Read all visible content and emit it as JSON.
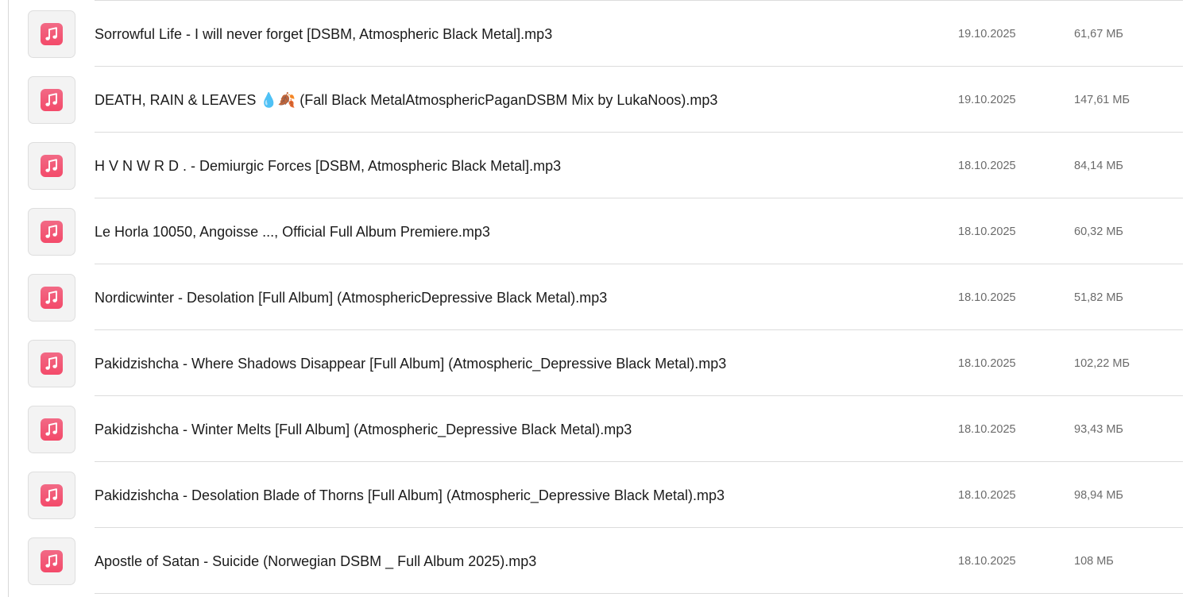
{
  "files": [
    {
      "name": "Sorrowful Life - I will never forget [DSBM, Atmospheric Black Metal].mp3",
      "date": "19.10.2025",
      "size": "61,67 МБ",
      "icon": "music-note-icon"
    },
    {
      "name": "DEATH, RAIN & LEAVES 💧🍂 (Fall Black MetalAtmosphericPaganDSBM Mix by LukaNoos).mp3",
      "date": "19.10.2025",
      "size": "147,61 МБ",
      "icon": "music-note-icon"
    },
    {
      "name": "H V N W R D . - Demiurgic Forces [DSBM, Atmospheric Black Metal].mp3",
      "date": "18.10.2025",
      "size": "84,14 МБ",
      "icon": "music-note-icon"
    },
    {
      "name": "Le Horla 10050, Angoisse ...,  Official Full Album Premiere.mp3",
      "date": "18.10.2025",
      "size": "60,32 МБ",
      "icon": "music-note-icon"
    },
    {
      "name": "Nordicwinter - Desolation [Full Album] (AtmosphericDepressive Black Metal).mp3",
      "date": "18.10.2025",
      "size": "51,82 МБ",
      "icon": "music-note-icon"
    },
    {
      "name": "Pakidzishcha - Where Shadows Disappear [Full Album] (Atmospheric_Depressive Black Metal).mp3",
      "date": "18.10.2025",
      "size": "102,22 МБ",
      "icon": "music-note-icon"
    },
    {
      "name": "Pakidzishcha - Winter Melts [Full Album] (Atmospheric_Depressive Black Metal).mp3",
      "date": "18.10.2025",
      "size": "93,43 МБ",
      "icon": "music-note-icon"
    },
    {
      "name": "Pakidzishcha - Desolation Blade of Thorns [Full Album] (Atmospheric_Depressive Black Metal).mp3",
      "date": "18.10.2025",
      "size": "98,94 МБ",
      "icon": "music-note-icon"
    },
    {
      "name": "Apostle of Satan - Suicide  (Norwegian DSBM _ Full Album  2025).mp3",
      "date": "18.10.2025",
      "size": "108 МБ",
      "icon": "music-note-icon"
    }
  ],
  "colors": {
    "icon_gradient_top": "#f26a86",
    "icon_gradient_bottom": "#f34a6a",
    "text_primary": "#1b1b1b",
    "text_secondary": "#6b6b6b",
    "divider": "#dcdcdc"
  }
}
